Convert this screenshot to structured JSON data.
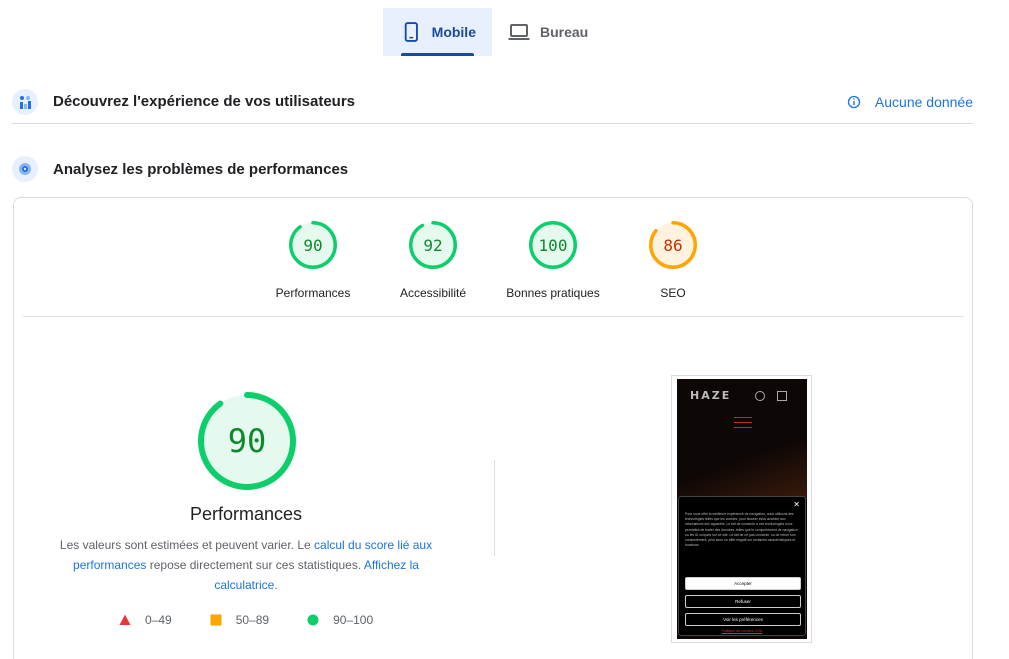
{
  "tabs": [
    {
      "label": "Mobile",
      "icon": "smartphone-icon",
      "active": true
    },
    {
      "label": "Bureau",
      "icon": "laptop-icon",
      "active": false
    }
  ],
  "section_experience": {
    "title": "Découvrez l'expérience de vos utilisateurs",
    "status": "Aucune donnée",
    "icon": "users-chart-icon"
  },
  "section_performance": {
    "title": "Analysez les problèmes de performances",
    "icon": "lighthouse-icon"
  },
  "scores": [
    {
      "label": "Performances",
      "value": "90",
      "color": "#0cce6b",
      "text_color": "#0b8a2b"
    },
    {
      "label": "Accessibilité",
      "value": "92",
      "color": "#0cce6b",
      "text_color": "#0b8a2b"
    },
    {
      "label": "Bonnes pratiques",
      "value": "100",
      "color": "#0cce6b",
      "text_color": "#0b8a2b"
    },
    {
      "label": "SEO",
      "value": "86",
      "color": "#ffa400",
      "text_color": "#c33300"
    }
  ],
  "main_score": {
    "value": "90",
    "title": "Performances",
    "desc_part1": "Les valeurs sont estimées et peuvent varier. Le ",
    "desc_link1": "calcul du score lié aux performances",
    "desc_part2": " repose directement sur ces statistiques. ",
    "desc_link2": "Affichez la calculatrice",
    "desc_end": "."
  },
  "legend": [
    {
      "range": "0–49",
      "color": "#e53935",
      "shape": "triangle"
    },
    {
      "range": "50–89",
      "color": "#ffa400",
      "shape": "square"
    },
    {
      "range": "90–100",
      "color": "#0cce6b",
      "shape": "circle"
    }
  ],
  "screenshot": {
    "logo": "HAZE",
    "cookie_text": "Pour vous offrir la meilleure expérience de navigation, nous utilisons des technologies telles que les cookies, pour stocker et/ou accéder aux informations des appareils. Le fait de consentir à ces technologies nous permettra de traiter des données, telles que le comportement de navigation ou les ID uniques sur ce site. Le fait de ne pas consentir, ou de retirer son consentement, peut avoir un effet négatif sur certaines caractéristiques et fonctions.",
    "accept_label": "Accepter",
    "refuse_label": "Refuser",
    "prefs_label": "Voir les préférences",
    "links": "Politique de cookies   CGU"
  }
}
